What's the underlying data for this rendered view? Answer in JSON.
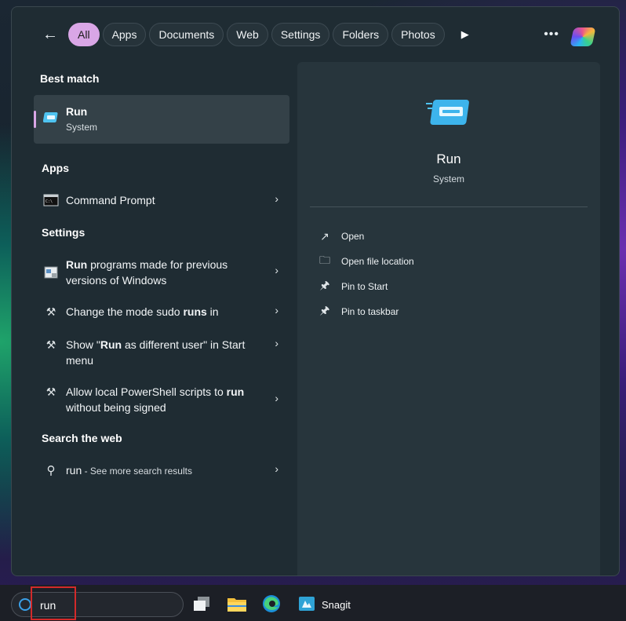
{
  "filters": {
    "chips": [
      "All",
      "Apps",
      "Documents",
      "Web",
      "Settings",
      "Folders",
      "Photos"
    ],
    "active": "All"
  },
  "best_match": {
    "heading": "Best match",
    "title": "Run",
    "subtitle": "System"
  },
  "apps": {
    "heading": "Apps",
    "items": [
      {
        "label": "Command Prompt"
      }
    ]
  },
  "settings": {
    "heading": "Settings",
    "items": [
      {
        "bold": "Run",
        "rest": " programs made for previous versions of Windows"
      },
      {
        "pre": "Change the mode sudo ",
        "bold": "runs",
        "rest": " in"
      },
      {
        "pre": "Show \"",
        "bold": "Run",
        "rest": " as different user\" in Start menu"
      },
      {
        "pre": "Allow local PowerShell scripts to ",
        "bold": "run",
        "rest": " without being signed"
      }
    ]
  },
  "web": {
    "heading": "Search the web",
    "query": "run",
    "suffix": " - See more search results"
  },
  "detail": {
    "title": "Run",
    "subtitle": "System",
    "actions": [
      "Open",
      "Open file location",
      "Pin to Start",
      "Pin to taskbar"
    ]
  },
  "taskbar": {
    "search_value": "run",
    "snagit_label": "Snagit"
  },
  "colors": {
    "accent": "#d9a6e6",
    "highlight": "#d32a2a"
  }
}
